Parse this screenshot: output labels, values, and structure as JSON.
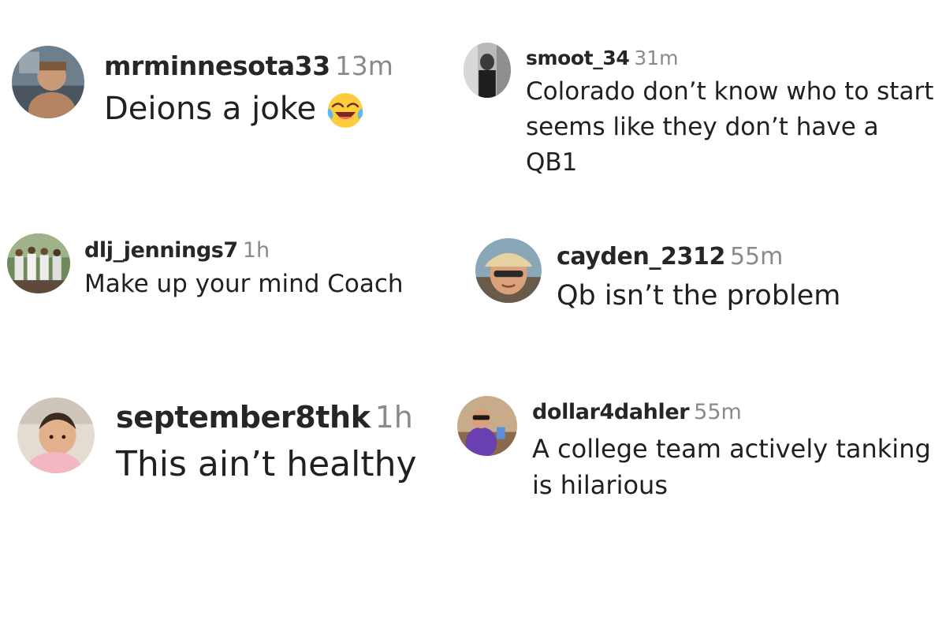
{
  "comments": [
    {
      "username": "mrminnesota33",
      "time": "13m",
      "text": "Deions a joke",
      "emoji": "face-with-tears-of-joy-icon"
    },
    {
      "username": "smoot_34",
      "time": "31m",
      "text": "Colorado don’t know who to start seems like they don’t have a QB1"
    },
    {
      "username": "dlj_jennings7",
      "time": "1h",
      "text": "Make up your mind Coach"
    },
    {
      "username": "cayden_2312",
      "time": "55m",
      "text": "Qb isn’t the problem"
    },
    {
      "username": "september8thk",
      "time": "1h",
      "text": "This ain’t healthy"
    },
    {
      "username": "dollar4dahler",
      "time": "55m",
      "text": "A college team actively tanking is hilarious"
    }
  ],
  "colors": {
    "background": "#ffffff",
    "username": "#262626",
    "time": "#8a8a8a",
    "text": "#202020"
  }
}
